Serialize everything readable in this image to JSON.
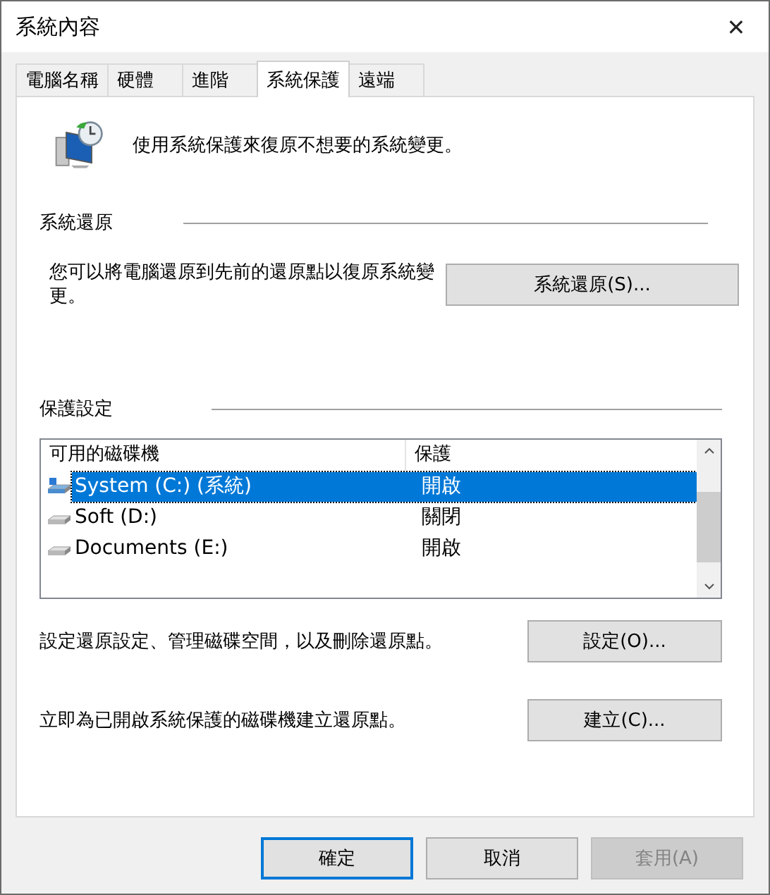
{
  "window": {
    "title": "系統內容",
    "close": "✕"
  },
  "tabs": [
    {
      "label": "電腦名稱",
      "selected": false
    },
    {
      "label": "硬體",
      "selected": false
    },
    {
      "label": "進階",
      "selected": false
    },
    {
      "label": "系統保護",
      "selected": true
    },
    {
      "label": "遠端",
      "selected": false
    }
  ],
  "intro": "使用系統保護來復原不想要的系統變更。",
  "restore": {
    "heading": "系統還原",
    "text": "您可以將電腦還原到先前的還原點以復原系統變更。",
    "button": "系統還原(S)..."
  },
  "protection": {
    "heading": "保護設定",
    "columns": [
      "可用的磁碟機",
      "保護"
    ],
    "rows": [
      {
        "kind": "system",
        "drive": "System (C:) (系統)",
        "status": "開啟",
        "selected": true
      },
      {
        "kind": "plain",
        "drive": "Soft (D:)",
        "status": "關閉",
        "selected": false
      },
      {
        "kind": "plain",
        "drive": "Documents (E:)",
        "status": "開啟",
        "selected": false
      }
    ],
    "actions": [
      {
        "text": "設定還原設定、管理磁碟空間，以及刪除還原點。",
        "button": "設定(O)..."
      },
      {
        "text": "立即為已開啟系統保護的磁碟機建立還原點。",
        "button": "建立(C)..."
      }
    ]
  },
  "buttons": [
    {
      "label": "確定",
      "default": true,
      "disabled": false
    },
    {
      "label": "取消",
      "default": false,
      "disabled": false
    },
    {
      "label": "套用(A)",
      "default": false,
      "disabled": true
    }
  ]
}
